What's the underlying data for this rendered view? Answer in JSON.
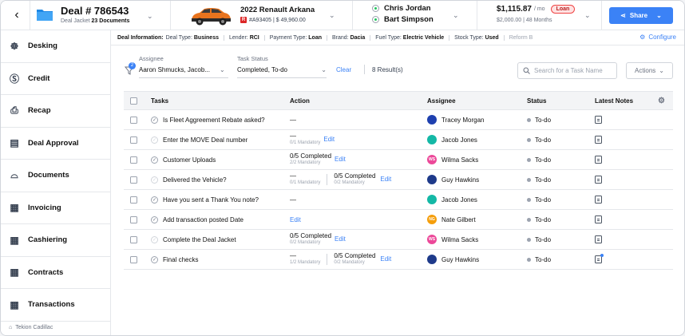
{
  "header": {
    "deal_title": "Deal # 786543",
    "deal_jacket_label": "Deal Jacket",
    "deal_docs": "23 Documents",
    "car_title": "2022 Renault Arkana",
    "car_badge": "R",
    "car_sub": "#A93405 | $ 49,960.00",
    "person1": "Chris Jordan",
    "person2": "Bart Simpson",
    "price": "$1,115.87",
    "price_unit": "/ mo",
    "loan_badge": "Loan",
    "price_sub": "$2,000.00 | 48 Months",
    "share_label": "Share"
  },
  "sidebar": {
    "items": [
      {
        "label": "Desking",
        "icon": "steering-wheel-icon"
      },
      {
        "label": "Credit",
        "icon": "dollar-circle-icon"
      },
      {
        "label": "Recap",
        "icon": "recap-icon"
      },
      {
        "label": "Deal Approval",
        "icon": "approval-icon"
      },
      {
        "label": "Documents",
        "icon": "documents-icon"
      },
      {
        "label": "Invoicing",
        "icon": "invoicing-icon"
      },
      {
        "label": "Cashiering",
        "icon": "cashiering-icon"
      },
      {
        "label": "Contracts",
        "icon": "contracts-icon"
      },
      {
        "label": "Transactions",
        "icon": "transactions-icon"
      }
    ],
    "footer": "Tekion Cadillac"
  },
  "infobar": {
    "title": "Deal Information:",
    "items": [
      {
        "key": "Deal Type:",
        "value": "Business"
      },
      {
        "key": "Lender:",
        "value": "RCI"
      },
      {
        "key": "Payment Type:",
        "value": "Loan"
      },
      {
        "key": "Brand:",
        "value": "Dacia"
      },
      {
        "key": "Fuel Type:",
        "value": "Electric Vehicle"
      },
      {
        "key": "Stock Type:",
        "value": "Used"
      },
      {
        "key": "Reform",
        "value": "B"
      }
    ],
    "configure_label": "Configure"
  },
  "filters": {
    "filter_count": "2",
    "assignee_label": "Assignee",
    "assignee_value": "Aaron Shmucks, Jacob...",
    "status_label": "Task Status",
    "status_value": "Completed, To-do",
    "clear_label": "Clear",
    "results": "8 Result(s)",
    "search_placeholder": "Search for a Task Name",
    "actions_label": "Actions"
  },
  "table": {
    "headers": {
      "tasks": "Tasks",
      "action": "Action",
      "assignee": "Assignee",
      "status": "Status",
      "notes": "Latest Notes"
    },
    "rows": [
      {
        "task": "Is Fleet Aggreement Rebate asked?",
        "faint": false,
        "action_type": "dash",
        "assignee": "Tracey Morgan",
        "av_color": "#1e40af",
        "av_text": "",
        "status": "To-do",
        "note_dot": false
      },
      {
        "task": "Enter the MOVE Deal number",
        "faint": true,
        "action_type": "dash-mand-edit",
        "a1_main": "—",
        "a1_sub": "0/1 Mandatory",
        "edit": "Edit",
        "assignee": "Jacob Jones",
        "av_color": "#14b8a6",
        "av_text": "",
        "status": "To-do",
        "note_dot": false
      },
      {
        "task": "Customer Uploads",
        "faint": false,
        "action_type": "comp-edit",
        "a1_main": "0/5 Completed",
        "a1_sub": "2/2 Mandatory",
        "edit": "Edit",
        "assignee": "Wilma Sacks",
        "av_color": "#ec4899",
        "av_text": "WS",
        "status": "To-do",
        "note_dot": false
      },
      {
        "task": "Delivered the Vehicle?",
        "faint": true,
        "action_type": "double",
        "a1_main": "—",
        "a1_sub": "0/1 Mandatory",
        "a2_main": "0/5 Completed",
        "a2_sub": "0/2 Mandatory",
        "edit": "Edit",
        "assignee": "Guy Hawkins",
        "av_color": "#1e3a8a",
        "av_text": "",
        "status": "To-do",
        "note_dot": false
      },
      {
        "task": "Have you sent a Thank You note?",
        "faint": false,
        "action_type": "dash",
        "assignee": "Jacob Jones",
        "av_color": "#14b8a6",
        "av_text": "",
        "status": "To-do",
        "note_dot": false
      },
      {
        "task": "Add transaction posted Date",
        "faint": false,
        "action_type": "edit-only",
        "edit": "Edit",
        "assignee": "Nate Gilbert",
        "av_color": "#f59e0b",
        "av_text": "NG",
        "status": "To-do",
        "note_dot": false
      },
      {
        "task": "Complete the Deal Jacket",
        "faint": true,
        "action_type": "comp-edit",
        "a1_main": "0/5 Completed",
        "a1_sub": "0/2 Mandatory",
        "edit": "Edit",
        "assignee": "Wilma Sacks",
        "av_color": "#ec4899",
        "av_text": "WS",
        "status": "To-do",
        "note_dot": false
      },
      {
        "task": "Final checks",
        "faint": false,
        "action_type": "double",
        "a1_main": "—",
        "a1_sub": "1/2 Mandatory",
        "a2_main": "0/5 Completed",
        "a2_sub": "0/2 Mandatory",
        "edit": "Edit",
        "assignee": "Guy Hawkins",
        "av_color": "#1e3a8a",
        "av_text": "",
        "status": "To-do",
        "note_dot": true
      }
    ]
  },
  "colors": {
    "accent": "#3b82f6",
    "loan": "#ef4444",
    "status_dot": "#9ca3af"
  }
}
